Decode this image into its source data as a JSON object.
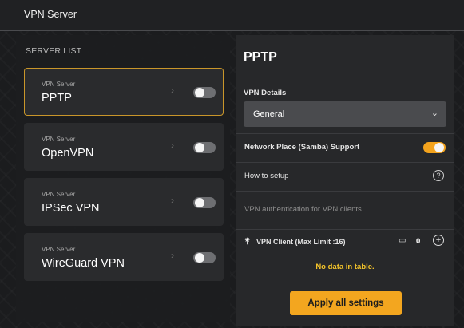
{
  "window": {
    "title": "VPN Server"
  },
  "server_list": {
    "label": "SERVER LIST",
    "items": [
      {
        "subtitle": "VPN Server",
        "name": "PPTP",
        "selected": true,
        "enabled": false
      },
      {
        "subtitle": "VPN Server",
        "name": "OpenVPN",
        "selected": false,
        "enabled": false
      },
      {
        "subtitle": "VPN Server",
        "name": "IPSec VPN",
        "selected": false,
        "enabled": false
      },
      {
        "subtitle": "VPN Server",
        "name": "WireGuard VPN",
        "selected": false,
        "enabled": false
      }
    ]
  },
  "details": {
    "title": "PPTP",
    "vpn_details_label": "VPN Details",
    "vpn_details_selected": "General",
    "samba_label": "Network Place (Samba) Support",
    "samba_enabled": true,
    "how_to_setup": "How to setup",
    "auth_label": "VPN authentication for VPN clients",
    "vpn_client_label": "VPN Client (Max Limit :16)",
    "vpn_client_count": "0",
    "no_data": "No data in table.",
    "apply_button": "Apply all settings"
  },
  "icons": {
    "chevron": "chevron-right-icon",
    "select": "chevron-down-icon",
    "help": "question-circle-icon",
    "key": "key-icon",
    "devices": "devices-icon",
    "add": "plus-circle-icon"
  },
  "colors": {
    "accent": "#f3a31d",
    "selected_border": "#c9962a",
    "no_data_text": "#f3c32a"
  }
}
